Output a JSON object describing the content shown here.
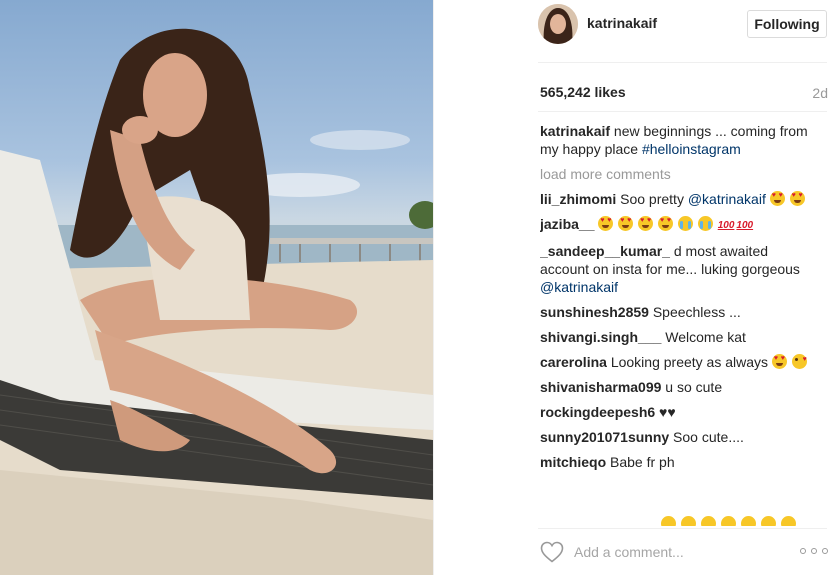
{
  "post": {
    "username": "katrinakaif",
    "follow_label": "Following",
    "likes": "565,242 likes",
    "time": "2d"
  },
  "caption": {
    "user": "katrinakaif",
    "text": " new beginnings ... coming from my happy place ",
    "hashtag": "#helloinstagram"
  },
  "load_more": "load more comments",
  "comments": [
    {
      "user": "lii_zhimomi",
      "text": " Soo pretty ",
      "mention": "@katrinakaif"
    },
    {
      "user": "jaziba__",
      "text": " "
    },
    {
      "user": "_sandeep__kumar_",
      "text": " d most awaited account on insta for me... luking gorgeous ",
      "mention": "@katrinakaif"
    },
    {
      "user": "sunshinesh2859",
      "text": " Speechless ..."
    },
    {
      "user": "shivangi.singh___",
      "text": " Welcome kat"
    },
    {
      "user": "carerolina",
      "text": " Looking preety as always "
    },
    {
      "user": "shivanisharma099",
      "text": " u so cute"
    },
    {
      "user": "rockingdeepesh6",
      "text": " "
    },
    {
      "user": "sunny201071sunny",
      "text": " Soo cute...."
    },
    {
      "user": "mitchieqo",
      "text": " Babe fr ph"
    }
  ],
  "comment_input": {
    "placeholder": "Add a comment..."
  },
  "icons": {
    "like": "heart-outline-icon",
    "more": "ellipsis-icon",
    "emoji_heart_eyes": "heart-eyes-emoji",
    "emoji_crying": "crying-emoji",
    "emoji_hundred": "hundred-emoji",
    "emoji_kiss": "kiss-emoji",
    "emoji_black_heart": "black-heart-emoji"
  },
  "colors": {
    "link": "#003569",
    "muted": "#999999",
    "text": "#262626",
    "border": "#dbdbdb"
  }
}
